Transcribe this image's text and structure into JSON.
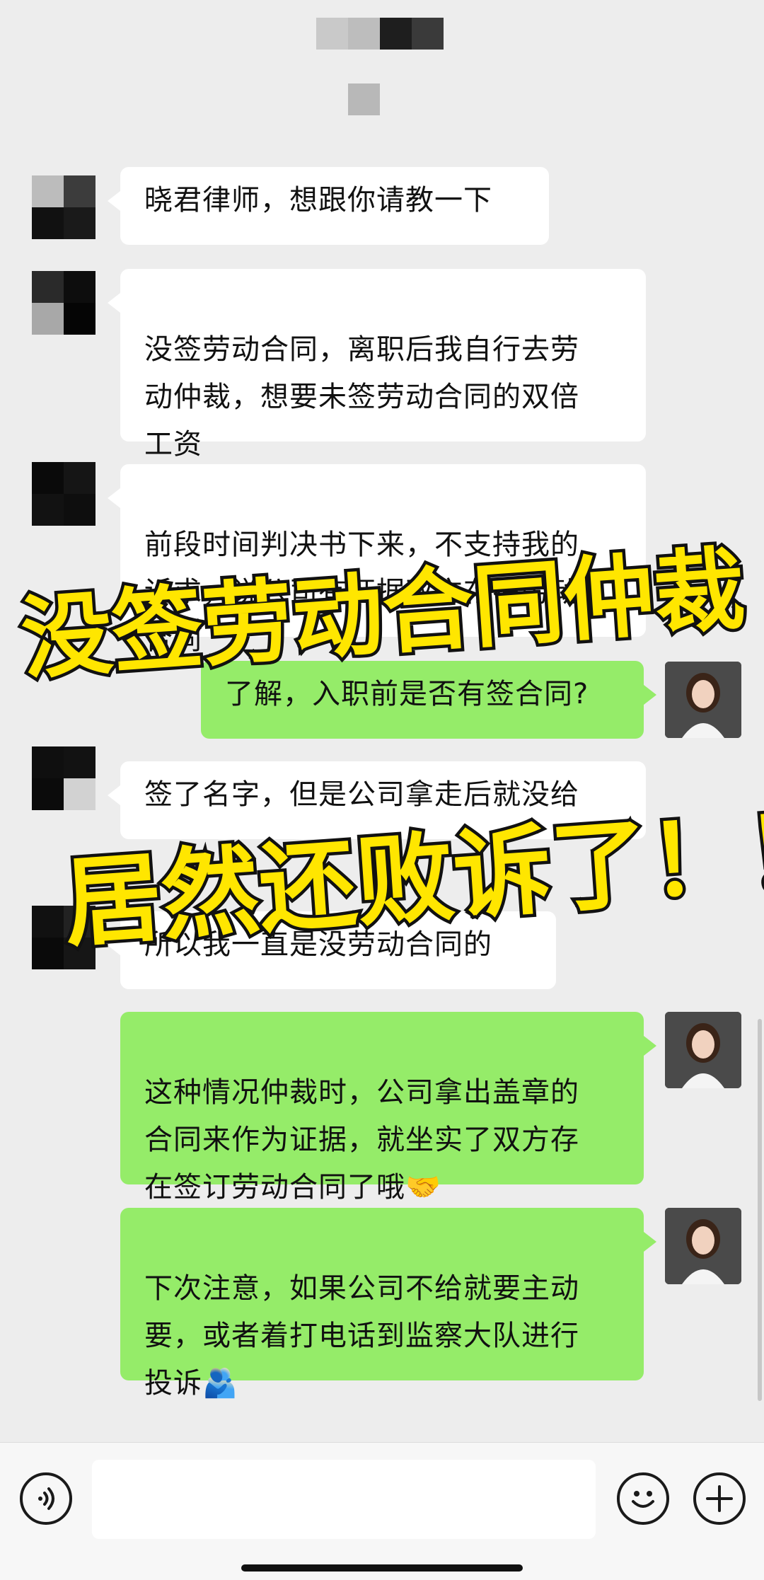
{
  "messages": [
    {
      "side": "left",
      "text": "晓君律师，想跟你请教一下"
    },
    {
      "side": "left",
      "text": "没签劳动合同，离职后我自行去劳\n动仲裁，想要未签劳动合同的双倍\n工资"
    },
    {
      "side": "left",
      "text": "前段时间判决书下来，不支持我的\n诉求，说公司有证据双方存在劳动\n合同"
    },
    {
      "side": "right",
      "text": "了解，入职前是否有签合同?"
    },
    {
      "side": "left",
      "text": "签了名字，但是公司拿走后就没给"
    },
    {
      "side": "left",
      "text": "所以我一直是没劳动合同的"
    },
    {
      "side": "right",
      "text": "这种情况仲裁时，公司拿出盖章的\n合同来作为证据，就坐实了双方存\n在签订劳动合同了哦🤝"
    },
    {
      "side": "right",
      "text": "下次注意，如果公司不给就要主动\n要，或者着打电话到监察大队进行\n投诉🫂"
    }
  ],
  "overlay": {
    "line1": "没签劳动合同仲裁",
    "line2": "居然还败诉了！！"
  },
  "colors": {
    "background": "#ededed",
    "bubble_self": "#95ec69",
    "bubble_other": "#ffffff",
    "overlay_text": "#ffe600",
    "overlay_stroke": "#111111"
  },
  "icons": {
    "voice": "voice-icon",
    "emoji": "emoji-icon",
    "plus": "plus-icon"
  }
}
